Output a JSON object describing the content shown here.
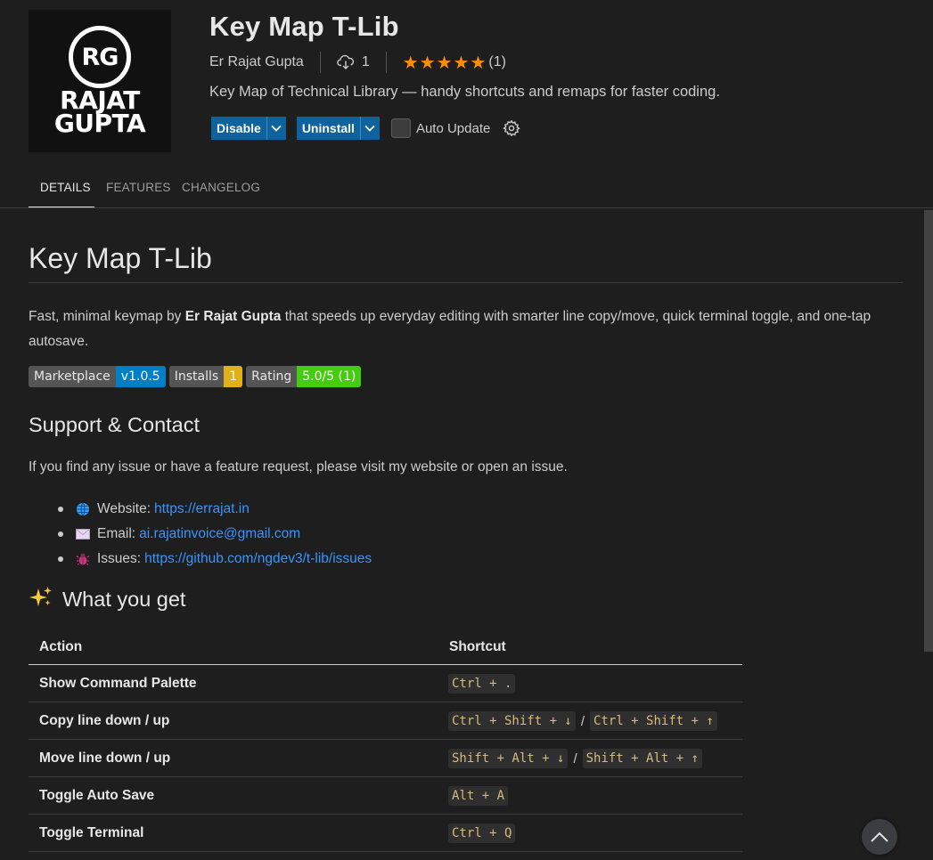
{
  "header": {
    "logo": {
      "mark": "RG",
      "line1": "RAJAT",
      "line2": "GUPTA"
    },
    "title": "Key Map T-Lib",
    "publisher": "Er Rajat Gupta",
    "installs": "1",
    "rating_count": "(1)",
    "stars": 5,
    "description": "Key Map of Technical Library — handy shortcuts and remaps for faster coding.",
    "disable_label": "Disable",
    "uninstall_label": "Uninstall",
    "auto_update_label": "Auto Update",
    "accent": "#0e639c",
    "star_color": "#ff8e00"
  },
  "tabs": [
    {
      "label": "DETAILS",
      "active": true
    },
    {
      "label": "FEATURES",
      "active": false
    },
    {
      "label": "CHANGELOG",
      "active": false
    }
  ],
  "readme": {
    "h1": "Key Map T-Lib",
    "intro_pre": "Fast, minimal keymap by ",
    "intro_bold": "Er Rajat Gupta",
    "intro_post": " that speeds up everyday editing with smarter line copy/move, quick terminal toggle, and one-tap autosave.",
    "badges": [
      {
        "key": "Marketplace",
        "value": "v1.0.5",
        "color": "#007ec6"
      },
      {
        "key": "Installs",
        "value": "1",
        "color": "#dfb317"
      },
      {
        "key": "Rating",
        "value": "5.0/5 (1)",
        "color": "#4c1"
      }
    ],
    "support_heading": "Support & Contact",
    "support_text": "If you find any issue or have a feature request, please visit my website or open an issue.",
    "links": [
      {
        "icon": "globe-icon",
        "label": "Website:",
        "url": "https://errajat.in"
      },
      {
        "icon": "envelope-icon",
        "label": "Email:",
        "url": "ai.rajatinvoice@gmail.com"
      },
      {
        "icon": "bug-icon",
        "label": "Issues:",
        "url": "https://github.com/ngdev3/t-lib/issues"
      }
    ],
    "features_heading": "What you get",
    "table": {
      "headers": [
        "Action",
        "Shortcut"
      ],
      "rows": [
        {
          "action": "Show Command Palette",
          "keys": [
            "Ctrl + ."
          ]
        },
        {
          "action": "Copy line down / up",
          "keys": [
            "Ctrl + Shift + ↓",
            "Ctrl + Shift + ↑"
          ]
        },
        {
          "action": "Move line down / up",
          "keys": [
            "Shift + Alt + ↓",
            "Shift + Alt + ↑"
          ]
        },
        {
          "action": "Toggle Auto Save",
          "keys": [
            "Alt + A"
          ]
        },
        {
          "action": "Toggle Terminal",
          "keys": [
            "Ctrl + Q"
          ]
        }
      ],
      "separator": "/"
    }
  }
}
